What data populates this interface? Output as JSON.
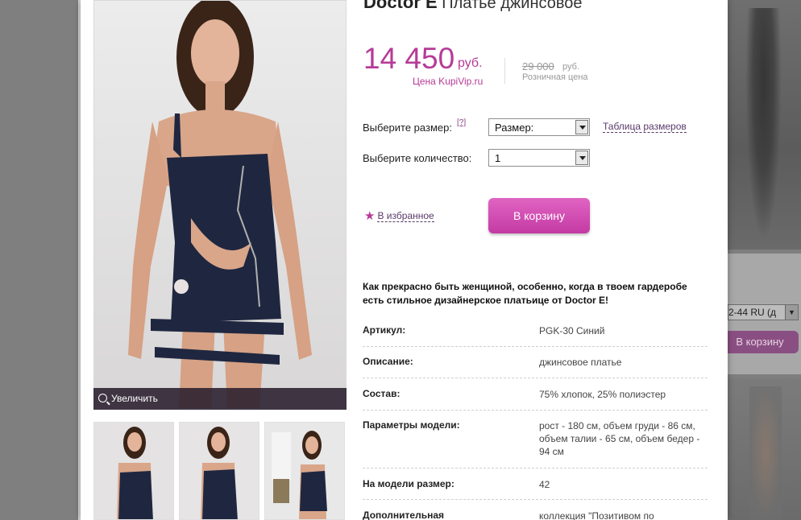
{
  "background": {
    "size_select": "2-44 RU (д",
    "cart_button": "В корзину"
  },
  "product": {
    "brand": "Doctor E",
    "name": "Платье джинсовое"
  },
  "price": {
    "value": "14 450",
    "currency": "руб.",
    "label": "Цена KupiVip.ru",
    "old_value": "29 000",
    "old_currency": "руб.",
    "old_label": "Розничная цена"
  },
  "gallery": {
    "zoom_label": "Увеличить"
  },
  "options": {
    "size_label": "Выберите размер:",
    "size_help": "[?]",
    "size_value": "Размер:",
    "size_table": "Таблица размеров",
    "qty_label": "Выберите количество:",
    "qty_value": "1"
  },
  "actions": {
    "favorite": "В избранное",
    "cart": "В корзину"
  },
  "description": "Как прекрасно быть женщиной, особенно, когда в твоем гардеробе есть стильное дизайнерское платьице от Doctor E!",
  "specs": [
    {
      "key": "Артикул:",
      "value": "PGK-30 Синий"
    },
    {
      "key": "Описание:",
      "value": "джинсовое платье"
    },
    {
      "key": "Состав:",
      "value": "75% хлопок, 25% полиэстер"
    },
    {
      "key": "Параметры модели:",
      "value": "рост - 180 см, объем груди - 86 см, объем талии - 65 см, объем бедер - 94 см"
    },
    {
      "key": "На модели размер:",
      "value": "42"
    },
    {
      "key": "Дополнительная",
      "value": "коллекция \"Позитивом по"
    }
  ],
  "colors": {
    "accent": "#b63b98",
    "button": "#d14fb4"
  }
}
